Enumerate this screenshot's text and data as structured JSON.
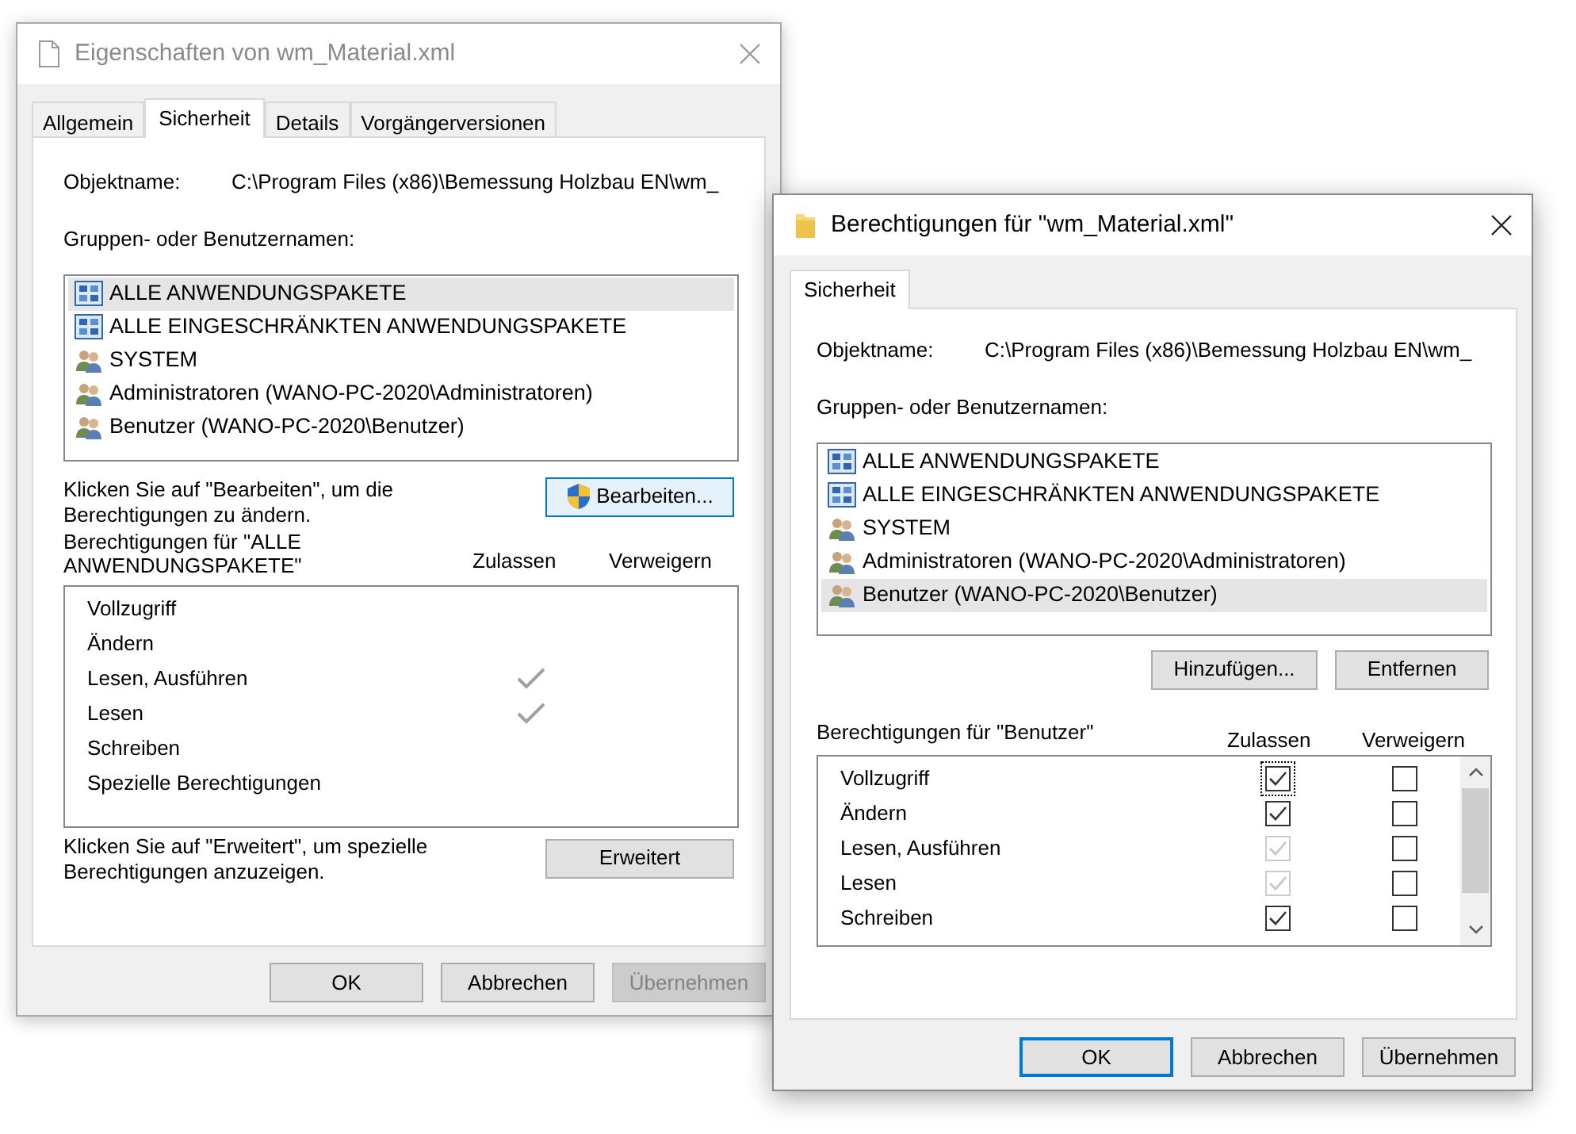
{
  "windows": [
    {
      "kind": "properties",
      "active": false,
      "title": "Eigenschaften von wm_Material.xml",
      "tabs": [
        {
          "label": "Allgemein",
          "selected": false
        },
        {
          "label": "Sicherheit",
          "selected": true
        },
        {
          "label": "Details",
          "selected": false
        },
        {
          "label": "Vorgängerversionen",
          "selected": false
        }
      ],
      "object_label": "Objektname:",
      "object_value": "C:\\Program Files (x86)\\Bemessung Holzbau EN\\wm_",
      "groups_label": "Gruppen- oder Benutzernamen:",
      "groups": [
        {
          "name": "ALLE ANWENDUNGSPAKETE",
          "kind": "package",
          "selected": true
        },
        {
          "name": "ALLE EINGESCHRÄNKTEN ANWENDUNGSPAKETE",
          "kind": "package",
          "selected": false
        },
        {
          "name": "SYSTEM",
          "kind": "group",
          "selected": false
        },
        {
          "name": "Administratoren (WANO-PC-2020\\Administratoren)",
          "kind": "group",
          "selected": false
        },
        {
          "name": "Benutzer (WANO-PC-2020\\Benutzer)",
          "kind": "group",
          "selected": false
        }
      ],
      "edit_hint": "Klicken Sie auf \"Bearbeiten\", um die Berechtigungen zu ändern.",
      "group_buttons": [
        {
          "label": "Bearbeiten...",
          "kind": "elevated",
          "focused": true
        }
      ],
      "perm_label": "Berechtigungen für \"ALLE ANWENDUNGSPAKETE\"",
      "allow_header": "Zulassen",
      "deny_header": "Verweigern",
      "permissions": [
        {
          "name": "Vollzugriff",
          "allow": false
        },
        {
          "name": "Ändern",
          "allow": false
        },
        {
          "name": "Lesen, Ausführen",
          "allow": true
        },
        {
          "name": "Lesen",
          "allow": true
        },
        {
          "name": "Schreiben",
          "allow": false
        },
        {
          "name": "Spezielle Berechtigungen",
          "allow": false
        }
      ],
      "advanced_hint": "Klicken Sie auf \"Erweitert\", um spezielle Berechtigungen anzuzeigen.",
      "advanced_button": "Erweitert",
      "buttons": [
        {
          "label": "OK",
          "default": false,
          "disabled": false
        },
        {
          "label": "Abbrechen",
          "default": false,
          "disabled": false
        },
        {
          "label": "Übernehmen",
          "default": false,
          "disabled": true
        }
      ]
    },
    {
      "kind": "permissions",
      "active": true,
      "title": "Berechtigungen für \"wm_Material.xml\"",
      "tabs": [
        {
          "label": "Sicherheit",
          "selected": true
        }
      ],
      "object_label": "Objektname:",
      "object_value": "C:\\Program Files (x86)\\Bemessung Holzbau EN\\wm_",
      "groups_label": "Gruppen- oder Benutzernamen:",
      "groups": [
        {
          "name": "ALLE ANWENDUNGSPAKETE",
          "kind": "package",
          "selected": false
        },
        {
          "name": "ALLE EINGESCHRÄNKTEN ANWENDUNGSPAKETE",
          "kind": "package",
          "selected": false
        },
        {
          "name": "SYSTEM",
          "kind": "group",
          "selected": false
        },
        {
          "name": "Administratoren (WANO-PC-2020\\Administratoren)",
          "kind": "group",
          "selected": false
        },
        {
          "name": "Benutzer (WANO-PC-2020\\Benutzer)",
          "kind": "group",
          "selected": true
        }
      ],
      "group_buttons": [
        {
          "label": "Hinzufügen...",
          "kind": "plain",
          "focused": false
        },
        {
          "label": "Entfernen",
          "kind": "plain",
          "focused": false
        }
      ],
      "perm_label": "Berechtigungen für \"Benutzer\"",
      "allow_header": "Zulassen",
      "deny_header": "Verweigern",
      "permissions": [
        {
          "name": "Vollzugriff",
          "allow": true,
          "allow_disabled": false,
          "deny": false,
          "focused": true
        },
        {
          "name": "Ändern",
          "allow": true,
          "allow_disabled": false,
          "deny": false,
          "focused": false
        },
        {
          "name": "Lesen, Ausführen",
          "allow": true,
          "allow_disabled": true,
          "deny": false,
          "focused": false
        },
        {
          "name": "Lesen",
          "allow": true,
          "allow_disabled": true,
          "deny": false,
          "focused": false
        },
        {
          "name": "Schreiben",
          "allow": true,
          "allow_disabled": false,
          "deny": false,
          "focused": false
        }
      ],
      "buttons": [
        {
          "label": "OK",
          "default": true,
          "disabled": false
        },
        {
          "label": "Abbrechen",
          "default": false,
          "disabled": false
        },
        {
          "label": "Übernehmen",
          "default": false,
          "disabled": false
        }
      ]
    }
  ]
}
